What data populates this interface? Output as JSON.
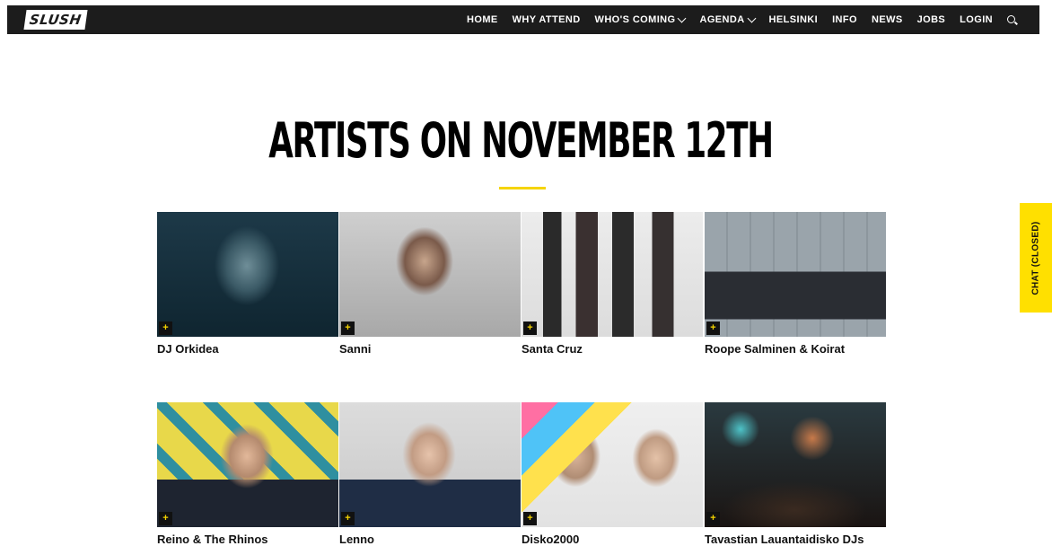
{
  "header": {
    "logo_text": "SLUSH",
    "nav": [
      {
        "label": "HOME",
        "dropdown": false
      },
      {
        "label": "WHY ATTEND",
        "dropdown": false
      },
      {
        "label": "WHO'S COMING",
        "dropdown": true
      },
      {
        "label": "AGENDA",
        "dropdown": true
      },
      {
        "label": "HELSINKI",
        "dropdown": false
      },
      {
        "label": "INFO",
        "dropdown": false
      },
      {
        "label": "NEWS",
        "dropdown": false
      },
      {
        "label": "JOBS",
        "dropdown": false
      },
      {
        "label": "LOGIN",
        "dropdown": false
      }
    ]
  },
  "main": {
    "title": "ARTISTS ON NOVEMBER 12TH",
    "accent_color": "#f5d400",
    "artists": [
      {
        "name": "DJ Orkidea",
        "plus": "+"
      },
      {
        "name": "Sanni",
        "plus": "+"
      },
      {
        "name": "Santa Cruz",
        "plus": "+"
      },
      {
        "name": "Roope Salminen & Koirat",
        "plus": "+"
      },
      {
        "name": "Reino & The Rhinos",
        "plus": "+"
      },
      {
        "name": "Lenno",
        "plus": "+"
      },
      {
        "name": "Disko2000",
        "plus": "+"
      },
      {
        "name": "Tavastian Lauantaidisko DJs",
        "plus": "+"
      }
    ]
  },
  "chat": {
    "label": "CHAT (CLOSED)",
    "color": "#ffe000"
  }
}
